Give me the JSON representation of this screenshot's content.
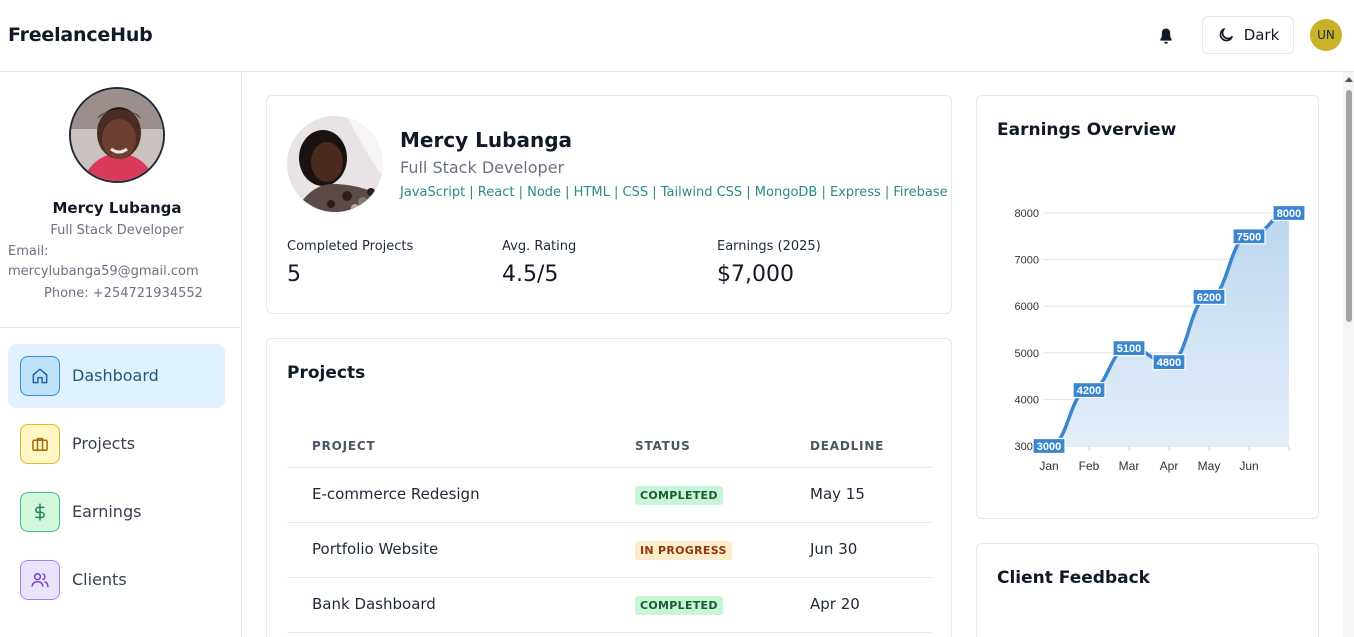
{
  "app": {
    "brand": "FreelanceHub"
  },
  "header": {
    "theme_label": "Dark",
    "user_initials": "UN"
  },
  "sidebar": {
    "name": "Mercy Lubanga",
    "role": "Full Stack Developer",
    "email_label": "Email:",
    "email": "mercylubanga59@gmail.com",
    "phone": "Phone: +254721934552",
    "nav": [
      {
        "label": "Dashboard",
        "icon": "home-icon",
        "color": "#3b82f6"
      },
      {
        "label": "Projects",
        "icon": "briefcase-icon",
        "color": "#d4a017"
      },
      {
        "label": "Earnings",
        "icon": "dollar-icon",
        "color": "#22a355"
      },
      {
        "label": "Clients",
        "icon": "users-icon",
        "color": "#8b5cf6"
      }
    ]
  },
  "profile": {
    "name": "Mercy Lubanga",
    "role": "Full Stack Developer",
    "skills": "JavaScript | React | Node | HTML | CSS | Tailwind CSS | MongoDB | Express | Firebase",
    "stats": [
      {
        "label": "Completed Projects",
        "value": "5"
      },
      {
        "label": "Avg. Rating",
        "value": "4.5/5"
      },
      {
        "label": "Earnings (2025)",
        "value": "$7,000"
      }
    ]
  },
  "projects": {
    "title": "Projects",
    "columns": [
      "PROJECT",
      "STATUS",
      "DEADLINE"
    ],
    "rows": [
      {
        "name": "E-commerce Redesign",
        "status": "COMPLETED",
        "deadline": "May 15"
      },
      {
        "name": "Portfolio Website",
        "status": "IN PROGRESS",
        "deadline": "Jun 30"
      },
      {
        "name": "Bank Dashboard",
        "status": "COMPLETED",
        "deadline": "Apr 20"
      }
    ]
  },
  "earnings": {
    "title": "Earnings Overview"
  },
  "chart_data": {
    "type": "area",
    "categories": [
      "Jan",
      "Feb",
      "Mar",
      "Apr",
      "May",
      "Jun"
    ],
    "values": [
      3000,
      4200,
      5100,
      4800,
      6200,
      7500,
      8000
    ],
    "yticks": [
      3000,
      4000,
      5000,
      6000,
      7000,
      8000
    ],
    "ylim": [
      3000,
      8000
    ],
    "line_color": "#3a87d0",
    "fill_color": "#bcd7f0",
    "grid": true
  },
  "feedback": {
    "title": "Client Feedback"
  }
}
